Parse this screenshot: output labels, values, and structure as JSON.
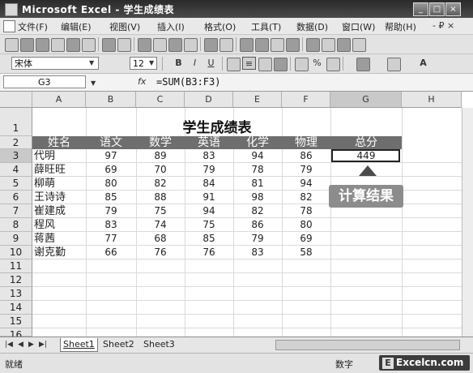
{
  "window": {
    "title": "Microsoft Excel - 学生成绩表",
    "minimize": "_",
    "restore": "□",
    "close": "×"
  },
  "menu": {
    "items": [
      "文件(F)",
      "编辑(E)",
      "视图(V)",
      "插入(I)",
      "格式(O)",
      "工具(T)",
      "数据(D)",
      "窗口(W)",
      "帮助(H)"
    ],
    "doc_controls": "- ₽ ×"
  },
  "format_toolbar": {
    "font": "宋体",
    "size": "12",
    "bold": "B",
    "italic": "I",
    "underline": "U",
    "percent": "%"
  },
  "formula_bar": {
    "name_box": "G3",
    "fx": "fx",
    "formula": "=SUM(B3:F3)"
  },
  "columns": [
    "A",
    "B",
    "C",
    "D",
    "E",
    "F",
    "G",
    "H"
  ],
  "rows": [
    "1",
    "2",
    "3",
    "4",
    "5",
    "6",
    "7",
    "8",
    "9",
    "10",
    "11",
    "12",
    "13",
    "14",
    "15",
    "16"
  ],
  "sheet": {
    "title": "学生成绩表",
    "headers": [
      "姓名",
      "语文",
      "数学",
      "英语",
      "化学",
      "物理",
      "总分"
    ],
    "students": [
      {
        "name": "代明",
        "scores": [
          "97",
          "89",
          "83",
          "94",
          "86"
        ],
        "total": "449"
      },
      {
        "name": "薛旺旺",
        "scores": [
          "69",
          "70",
          "79",
          "78",
          "79"
        ],
        "total": ""
      },
      {
        "name": "柳萌",
        "scores": [
          "80",
          "82",
          "84",
          "81",
          "94"
        ],
        "total": ""
      },
      {
        "name": "王诗诗",
        "scores": [
          "85",
          "88",
          "91",
          "98",
          "82"
        ],
        "total": ""
      },
      {
        "name": "崔建成",
        "scores": [
          "79",
          "75",
          "94",
          "82",
          "78"
        ],
        "total": ""
      },
      {
        "name": "程风",
        "scores": [
          "83",
          "74",
          "75",
          "86",
          "80"
        ],
        "total": ""
      },
      {
        "name": "蒋茜",
        "scores": [
          "77",
          "68",
          "85",
          "79",
          "69"
        ],
        "total": ""
      },
      {
        "name": "谢克勤",
        "scores": [
          "66",
          "76",
          "76",
          "83",
          "58"
        ],
        "total": ""
      }
    ]
  },
  "callout": {
    "text": "计算结果"
  },
  "tabs": {
    "nav": [
      "|◀",
      "◀",
      "▶",
      "▶|"
    ],
    "sheets": [
      "Sheet1",
      "Sheet2",
      "Sheet3"
    ],
    "active": 0
  },
  "status": {
    "left": "就绪",
    "right": "数字",
    "watermark": "Excelcn.com",
    "watermark_icon": "E"
  }
}
